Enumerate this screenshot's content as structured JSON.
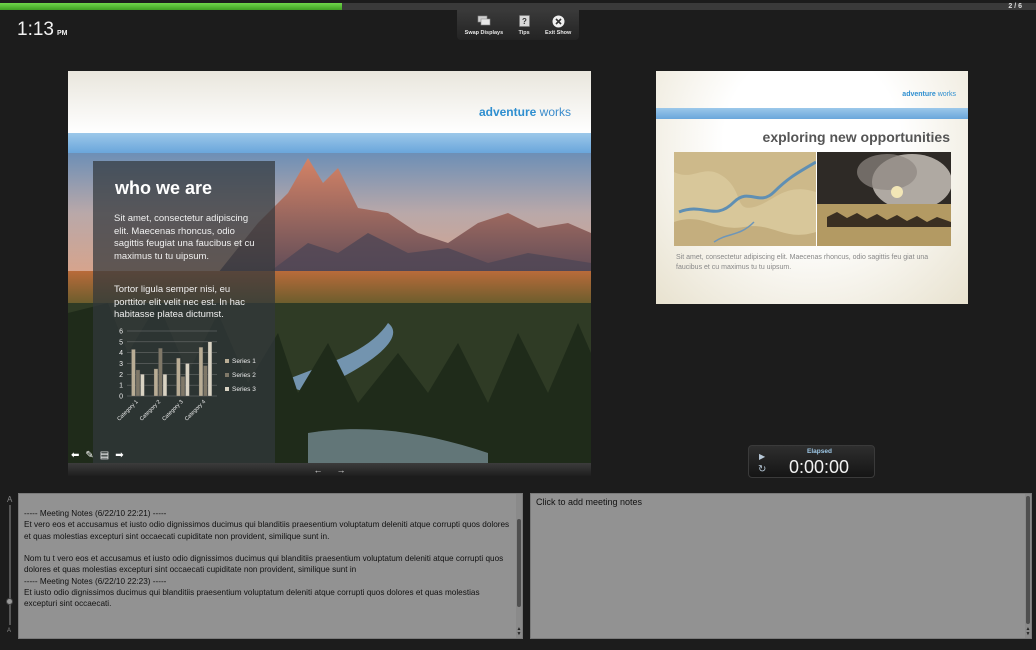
{
  "progress": {
    "fraction": 0.33,
    "counter": "2 / 6"
  },
  "clock": {
    "time": "1:13",
    "ampm": "PM"
  },
  "toolbar": {
    "swap_displays": "Swap Displays",
    "tips": "Tips",
    "exit_show": "Exit Show"
  },
  "current_slide": {
    "brand_bold": "adventure",
    "brand_light": "works",
    "title": "who we are",
    "para1": "Sit amet, consectetur adipiscing elit. Maecenas rhoncus, odio sagittis feugiat una faucibus et cu maximus tu tu uipsum.",
    "para2": "Tortor ligula semper nisi, eu porttitor elit velit nec est. In hac habitasse platea dictumst."
  },
  "chart_data": {
    "type": "bar",
    "categories": [
      "Category 1",
      "Category 2",
      "Category 3",
      "Category 4"
    ],
    "series": [
      {
        "name": "Series 1",
        "values": [
          4.3,
          2.5,
          3.5,
          4.5
        ]
      },
      {
        "name": "Series 2",
        "values": [
          2.4,
          4.4,
          1.8,
          2.8
        ]
      },
      {
        "name": "Series 3",
        "values": [
          2.0,
          2.0,
          3.0,
          5.0
        ]
      }
    ],
    "yticks": [
      "0",
      "1",
      "2",
      "3",
      "4",
      "5",
      "6"
    ],
    "ylim": [
      0,
      6
    ],
    "legend": "right",
    "colors": [
      "#b9ad95",
      "#7f7868",
      "#d9d3c3"
    ]
  },
  "next_slide": {
    "brand_bold": "adventure",
    "brand_light": "works",
    "title": "exploring new opportunities",
    "text": "Sit amet, consectetur adipiscing elit. Maecenas rhoncus, odio sagittis feu giat una faucibus  et cu maximus tu tu uipsum."
  },
  "timer": {
    "label": "Elapsed",
    "value": "0:00:00"
  },
  "notes": {
    "font_small": "A",
    "font_large": "A",
    "left_text": "----- Meeting Notes (6/22/10 22:21) -----\nEt vero eos et accusamus et iusto odio dignissimos ducimus qui blanditiis praesentium voluptatum deleniti atque corrupti quos dolores et quas molestias excepturi sint occaecati cupiditate non provident, similique sunt in.\n\nNom tu t vero eos et accusamus et iusto odio dignissimos ducimus qui blanditiis praesentium voluptatum deleniti atque corrupti quos dolores et quas molestias excepturi sint occaecati cupiditate non provident, similique sunt in\n----- Meeting Notes (6/22/10 22:23) -----\nEt iusto odio dignissimos ducimus qui blanditiis praesentium voluptatum deleniti atque corrupti quos dolores et quas molestias excepturi sint occaecati.",
    "right_placeholder": "Click to add meeting notes"
  }
}
